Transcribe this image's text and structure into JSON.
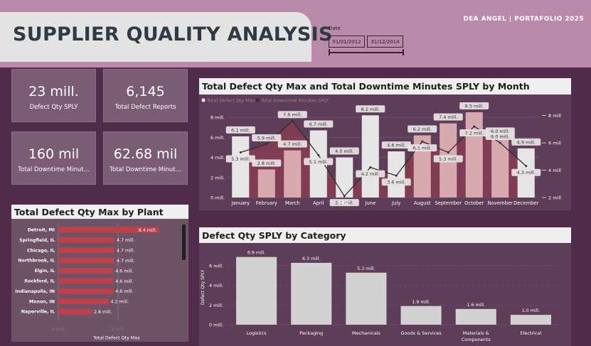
{
  "header": {
    "title": "SUPPLIER QUALITY ANALYSIS",
    "portfolio": "DEA ANGEL  |  PORTAFOLIO 2025",
    "date_label": "Date",
    "date_start": "01/01/2012",
    "date_end": "31/12/2014"
  },
  "kpis": [
    {
      "value": "23 mill.",
      "label": "Defect Qty SPLY"
    },
    {
      "value": "6,145",
      "label": "Total Defect Reports"
    },
    {
      "value": "160 mil",
      "label": "Total Downtime Minut..."
    },
    {
      "value": "62.68 mil",
      "label": "Total Downtime Minut..."
    }
  ],
  "panels": {
    "monthly_title": "Total Defect Qty Max and Total Downtime Minutes SPLY by Month",
    "plant_title": "Total Defect Qty Max by Plant",
    "category_title": "Defect Qty SPLY by Category"
  },
  "chart_data": [
    {
      "type": "bar",
      "title": "Total Defect Qty Max and Total Downtime Minutes SPLY by Month",
      "legend": [
        "Total Defect Qty Max",
        "Total Downtime Minutes SPLY"
      ],
      "categories": [
        "January",
        "February",
        "March",
        "April",
        "May",
        "June",
        "July",
        "August",
        "September",
        "October",
        "November",
        "December"
      ],
      "series": [
        {
          "name": "Total Defect Qty Max",
          "type": "bar",
          "values": [
            6.1,
            2.8,
            4.7,
            6.7,
            4.0,
            8.2,
            4.6,
            6.2,
            7.4,
            8.5,
            6.0,
            4.9
          ],
          "labels": [
            "6.1 mill.",
            "2.8 mill.",
            "4.7 mill.",
            "6.7 mill.",
            "4.0 mill.",
            "8.2 mill.",
            "4.6 mill.",
            "6.2 mill.",
            "7.4 mill.",
            "8.5 mill.",
            "6.0 mill.",
            "4.9 mill."
          ]
        },
        {
          "name": "Total Downtime Minutes SPLY",
          "type": "line",
          "values": [
            5.3,
            5.9,
            7.6,
            5.1,
            2.1,
            4.2,
            3.6,
            6.1,
            5.3,
            7.2,
            6.0,
            4.3
          ],
          "labels": [
            "5.3 mill.",
            "5.9 mill.",
            "7.6 mill.",
            "5.1 mill.",
            "2.1 mill.",
            "4.2 mill.",
            "3.6 mill.",
            "6.1 mill.",
            "5.3 mill.",
            "7.2 mill.",
            "6.0 mill.",
            "4.3 mill."
          ]
        }
      ],
      "y_ticks": [
        "0 mill.",
        "2 mill.",
        "4 mill.",
        "6 mill.",
        "8 mill."
      ],
      "y2_ticks": [
        "2 mill",
        "4 mill",
        "6 mill",
        "8 mill"
      ],
      "ylim": [
        0,
        9
      ],
      "y2lim": [
        2,
        8.6
      ],
      "colors": {
        "bar_light": "#e6e6e6",
        "bar_dark": "#d9a9b0",
        "band": "#8c3c52",
        "line": "#2f2f33"
      }
    },
    {
      "type": "bar",
      "orientation": "horizontal",
      "title": "Total Defect Qty Max by Plant",
      "categories": [
        "Detroit, MI",
        "Springfield, IL",
        "Chicago, IL",
        "Northbrook, IL",
        "Elgin, IL",
        "Rockford, IL",
        "Indianapolis, IN",
        "Monon, IN",
        "Naperville, IL"
      ],
      "values": [
        8.4,
        4.7,
        4.7,
        4.7,
        4.6,
        4.6,
        4.6,
        4.2,
        2.8
      ],
      "labels": [
        "8.4 mill.",
        "4.7 mill.",
        "4.7 mill.",
        "4.7 mill.",
        "4.6 mill.",
        "4.6 mill.",
        "4.6 mill.",
        "4.2 mill.",
        "2.8 mill."
      ],
      "x_ticks": [
        "0 mill.",
        "5 mill."
      ],
      "xlabel": "Total Defect Qty Max",
      "xlim": [
        0,
        10
      ],
      "colors": {
        "bar": "#c0404a"
      }
    },
    {
      "type": "bar",
      "title": "Defect Qty SPLY by Category",
      "categories": [
        "Logistics",
        "Packaging",
        "Mechanicals",
        "Goods & Services",
        "Materials & Components",
        "Electrical"
      ],
      "values": [
        6.9,
        6.3,
        5.3,
        1.9,
        1.6,
        1.0
      ],
      "labels": [
        "6.9 mill.",
        "6.3 mill.",
        "5.3 mill.",
        "1.9 mill.",
        "1.6 mill.",
        "1.0 mill."
      ],
      "y_ticks": [
        "0 mill.",
        "2 mill.",
        "4 mill.",
        "6 mill."
      ],
      "ylabel": "Defect Qty SPLY",
      "ylim": [
        0,
        7.6
      ],
      "colors": {
        "bar": "#d2d2d2"
      }
    }
  ]
}
